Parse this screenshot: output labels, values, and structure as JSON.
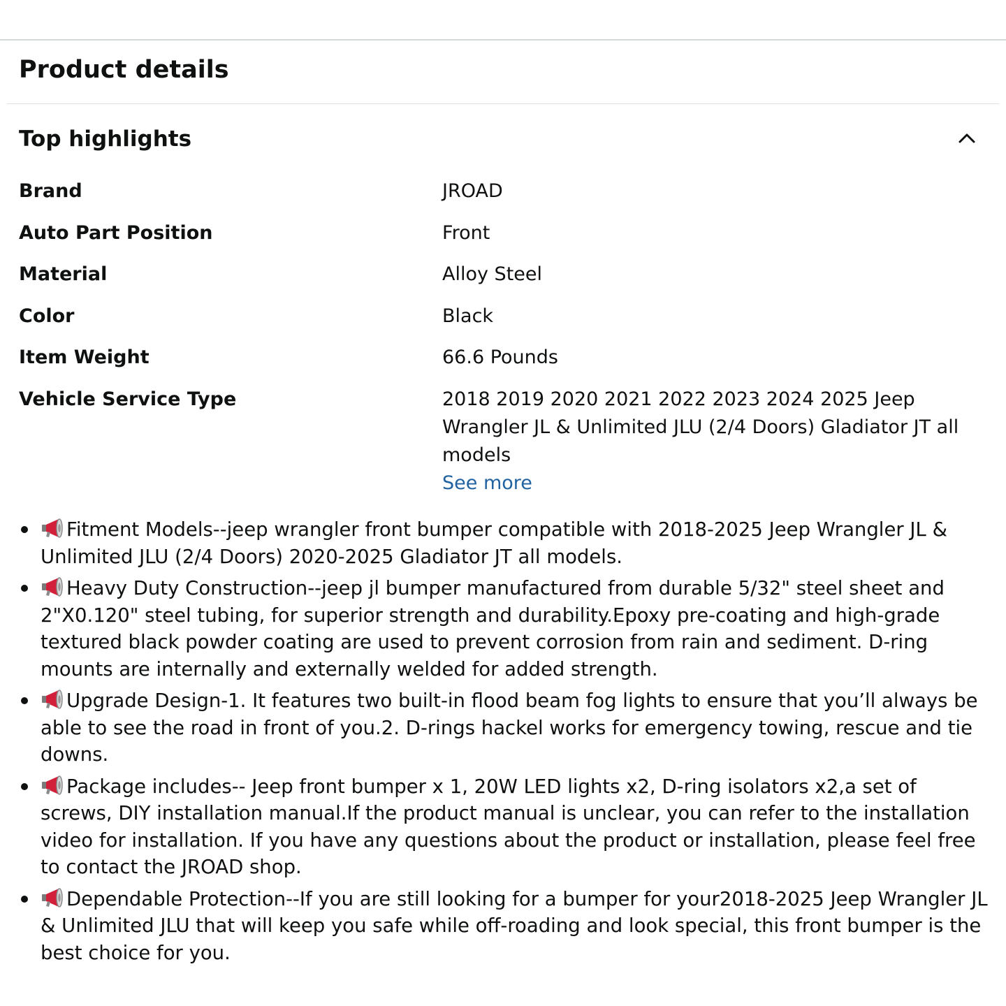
{
  "section": {
    "title": "Product details"
  },
  "highlights": {
    "title": "Top highlights",
    "toggle_icon": "chevron-up-icon",
    "rows": [
      {
        "key": "Brand",
        "value": "JROAD"
      },
      {
        "key": "Auto Part Position",
        "value": "Front"
      },
      {
        "key": "Material",
        "value": "Alloy Steel"
      },
      {
        "key": "Color",
        "value": "Black"
      },
      {
        "key": "Item Weight",
        "value": "66.6 Pounds"
      },
      {
        "key": "Vehicle Service Type",
        "value": "2018 2019 2020 2021 2022 2023 2024 2025 Jeep Wrangler JL & Unlimited JLU (2/4 Doors) Gladiator JT all models"
      }
    ],
    "see_more": "See more"
  },
  "bullet_icon": "megaphone-icon",
  "bullets": [
    "Fitment Models--jeep wrangler front bumper compatible with 2018-2025 Jeep Wrangler JL & Unlimited JLU (2/4 Doors) 2020-2025 Gladiator JT all models.",
    "Heavy Duty Construction--jeep jl bumper manufactured from durable 5/32\" steel sheet and 2\"X0.120\" steel tubing, for superior strength and durability.Epoxy pre-coating and high-grade textured black powder coating are used to prevent corrosion from rain and sediment. D-ring mounts are internally and externally welded for added strength.",
    "Upgrade Design-1. It features two built-in flood beam fog lights to ensure that you’ll always be able to see the road in front of you.2. D-rings hackel works for emergency towing, rescue and tie downs.",
    "Package includes-- Jeep front bumper x 1, 20W LED lights x2, D-ring isolators x2,a set of screws, DIY installation manual.If the product manual is unclear, you can refer to the installation video for installation. If you have any questions about the product or installation, please feel free to contact the JROAD shop.",
    "Dependable Protection--If you are still looking for a bumper for your2018-2025 Jeep Wrangler JL & Unlimited JLU that will keep you safe while off-roading and look special, this front bumper is the best choice for you."
  ],
  "colors": {
    "text": "#0f1111",
    "link": "#2162a1",
    "divider": "#d5d9d9",
    "megaphone": "#d3203a"
  }
}
